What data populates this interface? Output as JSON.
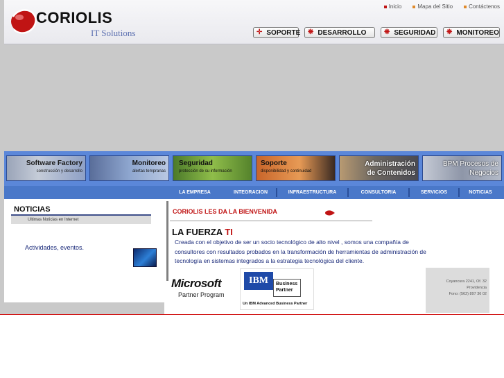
{
  "brand": {
    "name": "CORIOLIS",
    "tagline": "IT Solutions",
    "accent": "#c01414"
  },
  "top_links": [
    {
      "label": "Inicio",
      "color": "#c01414"
    },
    {
      "label": "Mapa del Sitio",
      "color": "#e08a2a"
    },
    {
      "label": "Contáctenos",
      "color": "#e08a2a"
    }
  ],
  "main_buttons": [
    {
      "label": "SOPORTE",
      "icon": "crosshair-icon"
    },
    {
      "label": "DESARROLLO",
      "icon": "gear-icon"
    },
    {
      "label": "SEGURIDAD",
      "icon": "gear-icon"
    },
    {
      "label": "MONITOREO",
      "icon": "gear-icon"
    }
  ],
  "service_tiles": [
    {
      "title": "Software Factory",
      "subtitle": "construcción y desarrollo"
    },
    {
      "title": "Monitoreo",
      "subtitle": "alertas tempranas"
    },
    {
      "title": "Seguridad",
      "subtitle": "protección de su información"
    },
    {
      "title": "Soporte",
      "subtitle": "disponibilidad y continuidad"
    },
    {
      "title": "Administración de Contenidos",
      "subtitle": ""
    },
    {
      "title": "BPM Procesos de Negocios",
      "subtitle": ""
    }
  ],
  "nav": [
    "LA EMPRESA",
    "INTEGRACION",
    "INFRAESTRUCTURA",
    "CONSULTORIA",
    "SERVICIOS",
    "NOTICIAS"
  ],
  "news": {
    "title": "NOTICIAS",
    "subtitle": "Ultimas Noticias en Internet",
    "link": "Actividades, eventos."
  },
  "welcome": {
    "heading": "CORIOLIS LES DA LA BIENVENIDA",
    "tagline_main": "LA FUERZA ",
    "tagline_accent": "TI",
    "paragraph": "Creada con el objetivo de ser un socio tecnológico de alto nivel , somos una compañía de consultores con resultados probados en la transformación de herramientas de administración de tecnología en sistemas integrados a la estrategia tecnológica del cliente."
  },
  "partners": {
    "microsoft": {
      "name": "Microsoft",
      "program": "Partner Program"
    },
    "ibm": {
      "logo": "IBM",
      "badge": "Business Partner",
      "caption": "Un IBM Advanced Business Partner"
    }
  },
  "address": {
    "line1": "Coyancura 2241, Of. 32",
    "line2": "Providencia",
    "line3": "Fono: (562) 897 36 02"
  }
}
